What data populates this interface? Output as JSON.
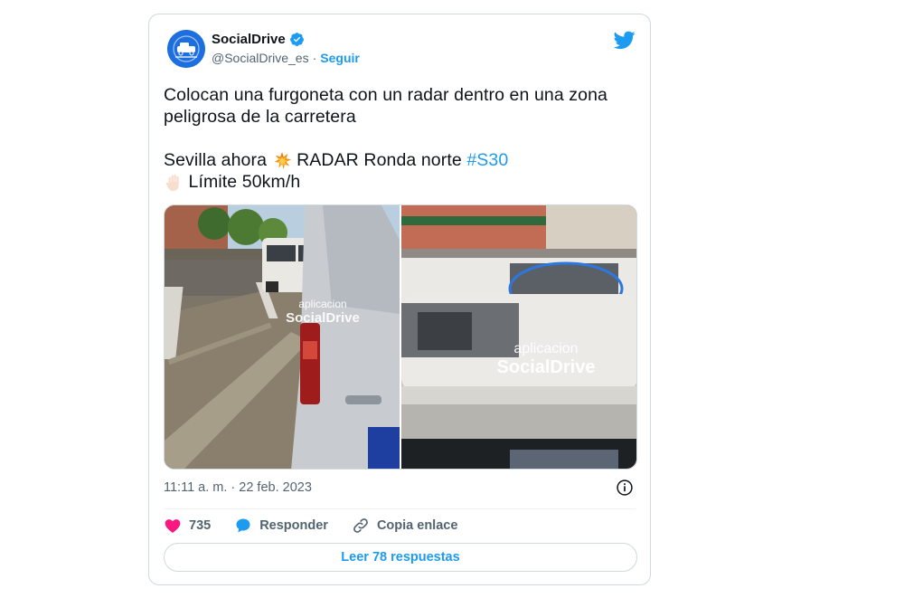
{
  "author": {
    "name": "SocialDrive",
    "handle": "@SocialDrive_es",
    "separator": "·",
    "follow_label": "Seguir"
  },
  "tweet": {
    "line1": "Colocan una furgoneta con un radar dentro en una zona peligrosa de la carretera",
    "line2_before": "Sevilla ahora",
    "line2_after": "RADAR Ronda norte",
    "hashtag": "#S30",
    "line3": "Límite 50km/h",
    "emoji_collision": "collision-emoji",
    "emoji_hand": "raised-hand-emoji"
  },
  "media": {
    "watermark_top": "aplicacion",
    "watermark_brand": "SocialDrive"
  },
  "timestamp": "11:11 a. m. · 22 feb. 2023",
  "actions": {
    "likes_count": "735",
    "reply_label": "Responder",
    "copy_label": "Copia enlace"
  },
  "replies_button": "Leer 78 respuestas",
  "colors": {
    "accent": "#1d9bf0",
    "like": "#f91880",
    "text": "#0f1419",
    "muted": "#536471",
    "border": "#cfd9de"
  }
}
